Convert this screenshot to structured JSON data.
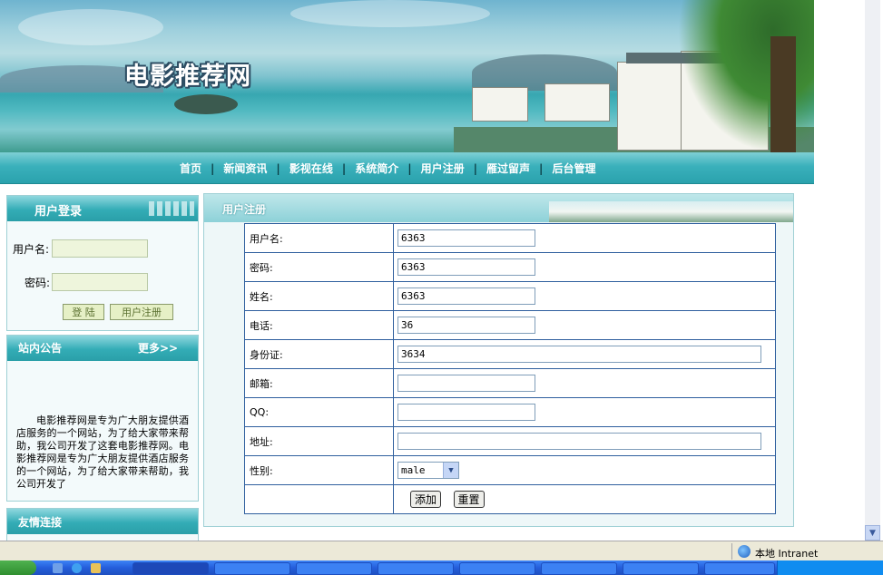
{
  "site": {
    "title": "电影推荐网"
  },
  "nav": {
    "items": [
      "首页",
      "新闻资讯",
      "影视在线",
      "系统简介",
      "用户注册",
      "雁过留声",
      "后台管理"
    ],
    "separator": "|"
  },
  "login": {
    "heading": "用户登录",
    "username_label": "用户名:",
    "username_value": "",
    "password_label": "密码:",
    "password_value": "",
    "login_button": "登 陆",
    "register_button": "用户注册"
  },
  "notice": {
    "heading": "站内公告",
    "more_label": "更多>>",
    "text": "电影推荐网是专为广大朋友提供酒店服务的一个网站，为了给大家带来帮助，我公司开发了这套电影推荐网。电影推荐网是专为广大朋友提供酒店服务的一个网站，为了给大家带来帮助，我公司开发了"
  },
  "links": {
    "heading": "友情连接"
  },
  "register": {
    "heading": "用户注册",
    "fields": {
      "username": {
        "label": "用户名:",
        "value": "6363"
      },
      "password": {
        "label": "密码:",
        "value": "6363"
      },
      "name": {
        "label": "姓名:",
        "value": "6363"
      },
      "phone": {
        "label": "电话:",
        "value": "36"
      },
      "id_card": {
        "label": "身份证:",
        "value": "3634"
      },
      "email": {
        "label": "邮箱:",
        "value": ""
      },
      "qq": {
        "label": "QQ:",
        "value": ""
      },
      "address": {
        "label": "地址:",
        "value": ""
      },
      "gender": {
        "label": "性别:",
        "value": "male"
      }
    },
    "add_button": "添加",
    "reset_button": "重置"
  },
  "browser": {
    "zone_text": "本地 Intranet"
  },
  "icons": {
    "zone": "globe-icon",
    "scroll_down": "arrow-down-icon",
    "select": "chevron-down-icon"
  },
  "colors": {
    "teal_bar": "#2aa2ad",
    "table_border": "#2f5f9e",
    "taskbar": "#245edb"
  }
}
